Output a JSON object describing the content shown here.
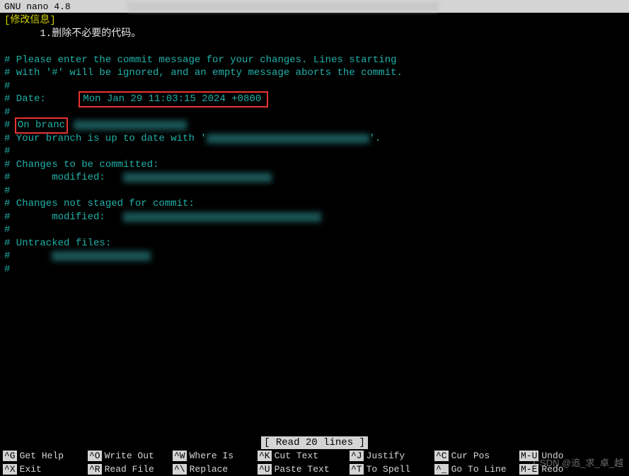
{
  "titleBar": {
    "appName": "GNU nano 4.8"
  },
  "content": {
    "header": "[修改信息]",
    "firstLine": "      1.删除不必要的代码。",
    "commentLines": {
      "l1": "# Please enter the commit message for your changes. Lines starting",
      "l2": "# with '#' will be ignored, and an empty message aborts the commit.",
      "l3": "#",
      "dateLabel": "# Date:      ",
      "dateValue": "Mon Jan 29 11:03:15 2024 +0800",
      "l5": "#",
      "branchPrefix": "# ",
      "branchText": "On branc",
      "branchLine2": "# Your branch is up to date with '",
      "branchSuffix": "'.",
      "l8": "#",
      "changesCommit": "# Changes to be committed:",
      "modified1Prefix": "#       modified:   ",
      "l11": "#",
      "changesNotStaged": "# Changes not staged for commit:",
      "modified2Prefix": "#       modified:   ",
      "l14": "#",
      "untracked": "# Untracked files:",
      "untrackedPrefix": "#       ",
      "l17": "#"
    }
  },
  "statusBar": {
    "text": "[ Read 20 lines ]"
  },
  "helpBar": {
    "row1": [
      {
        "key": "^G",
        "label": "Get Help"
      },
      {
        "key": "^O",
        "label": "Write Out"
      },
      {
        "key": "^W",
        "label": "Where Is"
      },
      {
        "key": "^K",
        "label": "Cut Text"
      },
      {
        "key": "^J",
        "label": "Justify"
      },
      {
        "key": "^C",
        "label": "Cur Pos"
      },
      {
        "key": "M-U",
        "label": "Undo"
      }
    ],
    "row2": [
      {
        "key": "^X",
        "label": "Exit"
      },
      {
        "key": "^R",
        "label": "Read File"
      },
      {
        "key": "^\\",
        "label": "Replace"
      },
      {
        "key": "^U",
        "label": "Paste Text"
      },
      {
        "key": "^T",
        "label": "To Spell"
      },
      {
        "key": "^_",
        "label": "Go To Line"
      },
      {
        "key": "M-E",
        "label": "Redo"
      }
    ]
  },
  "watermark": "CSDN @追_求_卓_越"
}
